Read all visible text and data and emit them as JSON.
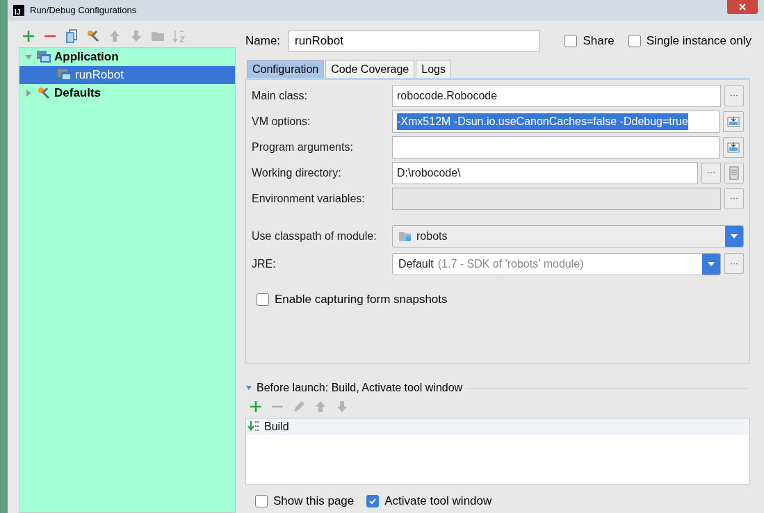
{
  "window": {
    "title": "Run/Debug Configurations",
    "app_icon": "IJ"
  },
  "tree_toolbar": [
    {
      "kind": "add",
      "disabled": false
    },
    {
      "kind": "remove",
      "disabled": false
    },
    {
      "kind": "copy",
      "disabled": false
    },
    {
      "kind": "wrench",
      "disabled": false
    },
    {
      "kind": "up",
      "disabled": true
    },
    {
      "kind": "down",
      "disabled": true
    },
    {
      "kind": "folder",
      "disabled": true
    },
    {
      "kind": "sort",
      "disabled": true
    }
  ],
  "tree": [
    {
      "label": "Application",
      "kind": "application",
      "expanded": true,
      "selected": false,
      "children": [
        {
          "label": "runRobot",
          "kind": "application",
          "selected": true
        }
      ]
    },
    {
      "label": "Defaults",
      "kind": "wrench",
      "expanded": false,
      "selected": false
    }
  ],
  "name_field": {
    "label": "Name:",
    "value": "runRobot"
  },
  "options": [
    {
      "label": "Share",
      "checked": false
    },
    {
      "label": "Single instance only",
      "checked": false
    }
  ],
  "tabs": [
    {
      "label": "Configuration",
      "selected": true
    },
    {
      "label": "Code Coverage",
      "selected": false
    },
    {
      "label": "Logs",
      "selected": false
    }
  ],
  "fields": [
    {
      "kind": "text",
      "label": "Main class:",
      "value": "robocode.Robocode",
      "highlighted": false,
      "disabled": false,
      "buttons": [
        {
          "kind": "browse"
        }
      ]
    },
    {
      "kind": "text",
      "label": "VM options:",
      "value": "-Xmx512M -Dsun.io.useCanonCaches=false -Ddebug=true",
      "highlighted": true,
      "disabled": false,
      "buttons": [
        {
          "kind": "expand"
        }
      ]
    },
    {
      "kind": "text",
      "label": "Program arguments:",
      "disabled": false,
      "buttons": [
        {
          "kind": "expand"
        }
      ]
    },
    {
      "kind": "text",
      "label": "Working directory:",
      "value": "D:\\robocode\\",
      "highlighted": false,
      "disabled": false,
      "buttons": [
        {
          "kind": "browse"
        },
        {
          "kind": "macro"
        }
      ]
    },
    {
      "kind": "text",
      "label": "Environment variables:",
      "disabled": true,
      "buttons": [
        {
          "kind": "browse"
        }
      ]
    },
    {
      "kind": "module",
      "label": "Use classpath of module:",
      "value": "robots"
    },
    {
      "kind": "jre",
      "label": "JRE:",
      "value": "Default",
      "hint": "(1.7 - SDK of 'robots' module)",
      "buttons": [
        {
          "kind": "browse"
        }
      ]
    }
  ],
  "enable_snapshots": {
    "label": "Enable capturing form snapshots",
    "checked": false
  },
  "before_launch": {
    "title": "Before launch: Build, Activate tool window",
    "expanded": true,
    "toolbar": [
      {
        "kind": "add",
        "disabled": false
      },
      {
        "kind": "remove",
        "disabled": true
      },
      {
        "kind": "edit",
        "disabled": true
      },
      {
        "kind": "up",
        "disabled": true
      },
      {
        "kind": "down",
        "disabled": true
      }
    ],
    "tasks": [
      {
        "label": "Build",
        "selected": true
      }
    ]
  },
  "bottom_options": [
    {
      "label": "Show this page",
      "checked": false
    },
    {
      "label": "Activate tool window",
      "checked": true
    }
  ]
}
